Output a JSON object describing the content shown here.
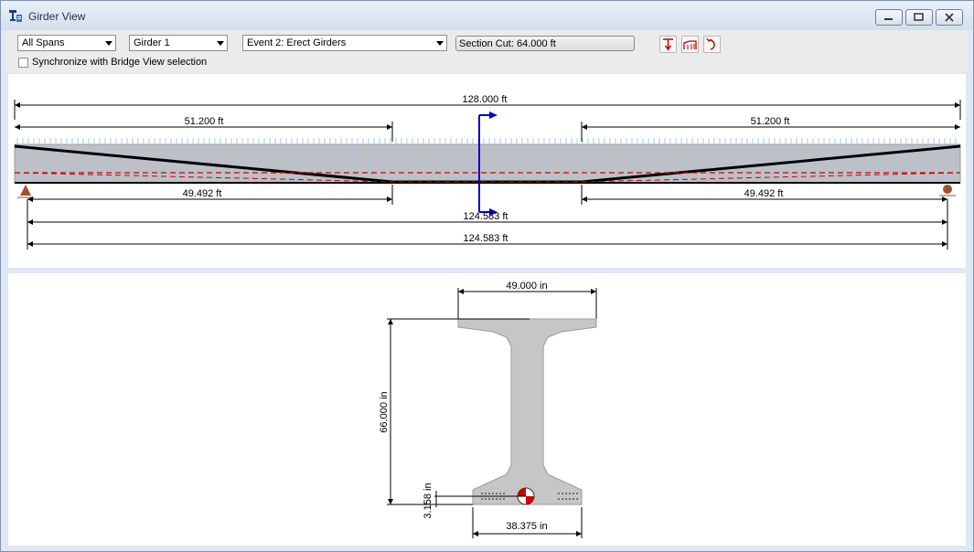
{
  "window": {
    "title": "Girder View"
  },
  "toolbar": {
    "span_select": "All Spans",
    "girder_select": "Girder 1",
    "event_select": "Event 2: Erect Girders",
    "section_cut_label": "Section Cut: 64.000 ft",
    "sync_label": "Synchronize with Bridge View selection",
    "sync_checked": false,
    "icons": [
      "load-arrow-icon",
      "bridge-profile-icon",
      "rotate-icon"
    ]
  },
  "elevation": {
    "overall_length": "128.000 ft",
    "left_harp": "51.200 ft",
    "right_harp": "51.200 ft",
    "left_bearing_to_harp": "49.492 ft",
    "right_bearing_to_harp": "49.492 ft",
    "span_length_1": "124.583 ft",
    "span_length_2": "124.583 ft"
  },
  "section": {
    "top_flange_width": "49.000 in",
    "height": "66.000 in",
    "strand_eccentricity": "3.158 in",
    "bottom_flange_width": "38.375 in"
  },
  "colors": {
    "accent_red": "#cc0000",
    "section_cut_blue": "#0000cc",
    "girder_gray": "#c0c0c0"
  }
}
